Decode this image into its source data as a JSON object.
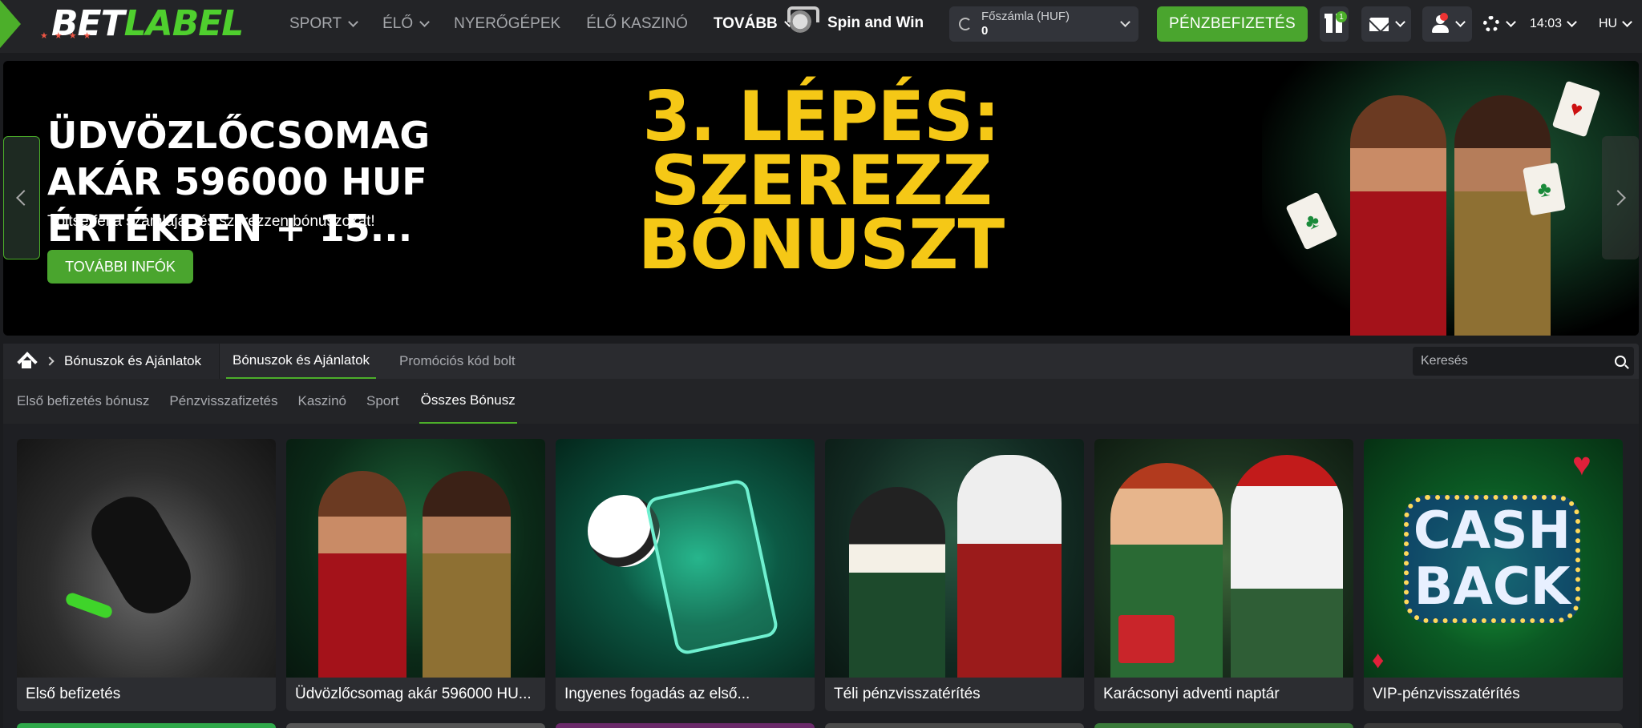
{
  "header": {
    "logo_bet": "BET",
    "logo_label": "LABEL",
    "nav": [
      {
        "label": "SPORT",
        "dropdown": true
      },
      {
        "label": "ÉLŐ",
        "dropdown": true
      },
      {
        "label": "NYERŐGÉPEK",
        "dropdown": false
      },
      {
        "label": "ÉLŐ KASZINÓ",
        "dropdown": false
      },
      {
        "label": "TOVÁBB",
        "dropdown": true
      }
    ],
    "spin_label": "Spin and Win",
    "account_label": "Főszámla  (HUF)",
    "account_balance": "0",
    "deposit_label": "PÉNZBEFIZETÉS",
    "gift_badge": "1",
    "time": "14:03",
    "lang": "HU",
    "colors": {
      "accent": "#4caf2a",
      "background": "#232427"
    }
  },
  "banner": {
    "title": "ÜDVÖZLŐCSOMAG AKÁR 596000 HUF ÉRTÉKBEN + 15...",
    "subtitle": "Töltse fel a számláját, és szerezzen bónuszokat!",
    "cta": "TOVÁBBI INFÓK",
    "step_line1": "3. LÉPÉS: SZEREZZ",
    "step_line2": "BÓNUSZT",
    "step_color": "#f5c816"
  },
  "tabbar": {
    "breadcrumb": "Bónuszok és Ajánlatok",
    "tabs": [
      "Bónuszok és Ajánlatok",
      "Promóciós kód bolt"
    ],
    "search_placeholder": "Keresés"
  },
  "filters": [
    "Első befizetés bónusz",
    "Pénzvisszafizetés",
    "Kaszinó",
    "Sport",
    "Összes Bónusz"
  ],
  "active_filter": "Összes Bónusz",
  "promos": [
    {
      "title": "Első befizetés"
    },
    {
      "title": "Üdvözlőcsomag akár 596000 HU..."
    },
    {
      "title": "Ingyenes fogadás az első..."
    },
    {
      "title": "Téli pénzvisszatérítés"
    },
    {
      "title": "Karácsonyi adventi naptár"
    },
    {
      "title": "VIP-pénzvisszatérítés"
    }
  ],
  "promo_art": {
    "cashback_line1": "CASH",
    "cashback_line2": "BACK"
  }
}
